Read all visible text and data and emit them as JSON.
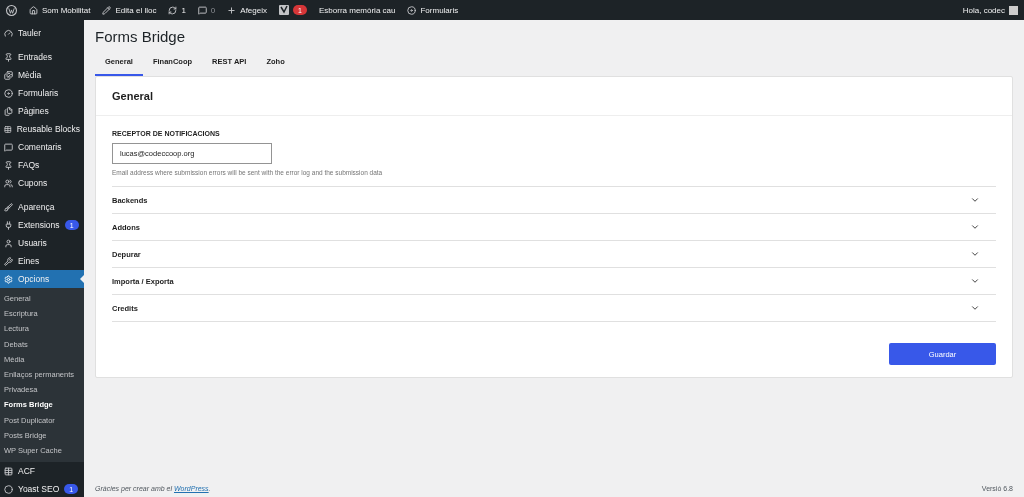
{
  "admin_bar": {
    "items": [
      {
        "kind": "logo"
      },
      {
        "kind": "home",
        "label": "Som Mobilitat"
      },
      {
        "kind": "edit",
        "label": "Edita el lloc"
      },
      {
        "kind": "updates",
        "label": "1"
      },
      {
        "kind": "comments",
        "label": "0"
      },
      {
        "kind": "new",
        "label": "Afegeix"
      },
      {
        "kind": "yoast",
        "badge": "1"
      },
      {
        "kind": "text",
        "label": "Esborra memòria cau"
      },
      {
        "kind": "forms",
        "label": "Formularis"
      }
    ],
    "greeting": "Hola, codec"
  },
  "sidebar": {
    "groups": [
      {
        "items": [
          {
            "kind": "dashboard",
            "label": "Tauler",
            "selected": false
          }
        ]
      },
      {
        "items": [
          {
            "kind": "pin",
            "label": "Entrades",
            "selected": false
          },
          {
            "kind": "media",
            "label": "Mèdia",
            "selected": false
          },
          {
            "kind": "forms",
            "label": "Formularis",
            "selected": false
          },
          {
            "kind": "pages",
            "label": "Pàgines",
            "selected": false
          },
          {
            "kind": "table",
            "label": "Reusable Blocks",
            "selected": false
          },
          {
            "kind": "comment",
            "label": "Comentaris",
            "selected": false
          },
          {
            "kind": "pin",
            "label": "FAQs",
            "selected": false
          },
          {
            "kind": "people",
            "label": "Cupons",
            "selected": false
          }
        ]
      },
      {
        "items": [
          {
            "kind": "brush",
            "label": "Aparença",
            "selected": false
          },
          {
            "kind": "plug",
            "label": "Extensions",
            "badge": "1",
            "selected": false
          },
          {
            "kind": "user",
            "label": "Usuaris",
            "selected": false
          },
          {
            "kind": "wrench",
            "label": "Eines",
            "selected": false
          },
          {
            "kind": "settings",
            "label": "Opcions",
            "selected": true,
            "children": [
              {
                "label": "General",
                "selected": false
              },
              {
                "label": "Escriptura",
                "selected": false
              },
              {
                "label": "Lectura",
                "selected": false
              },
              {
                "label": "Debats",
                "selected": false
              },
              {
                "label": "Mèdia",
                "selected": false
              },
              {
                "label": "Enllaços permanents",
                "selected": false
              },
              {
                "label": "Privadesa",
                "selected": false
              },
              {
                "label": "Forms Bridge",
                "selected": true
              },
              {
                "label": "Post Duplicator",
                "selected": false
              },
              {
                "label": "Posts Bridge",
                "selected": false
              },
              {
                "label": "WP Super Cache",
                "selected": false
              }
            ]
          },
          {
            "kind": "table",
            "label": "ACF",
            "selected": false
          },
          {
            "kind": "yoast",
            "label": "Yoast SEO",
            "badge": "1",
            "selected": false
          }
        ]
      }
    ]
  },
  "page": {
    "title": "Forms Bridge",
    "tabs": [
      {
        "label": "General",
        "selected": true
      },
      {
        "label": "FinanCoop",
        "selected": false
      },
      {
        "label": "REST API",
        "selected": false
      },
      {
        "label": "Zoho",
        "selected": false
      }
    ],
    "panel": {
      "heading": "General",
      "field": {
        "label": "RECEPTOR DE NOTIFICACIONS",
        "value": "lucas@codeccoop.org",
        "help": "Email address where submission errors will be sent with the error log and the submission data"
      },
      "sections": [
        {
          "label": "Backends",
          "expanded": false
        },
        {
          "label": "Addons",
          "expanded": false
        },
        {
          "label": "Depurar",
          "expanded": false
        },
        {
          "label": "Importa / Exporta",
          "expanded": false
        },
        {
          "label": "Credits",
          "expanded": false
        }
      ],
      "save": "Guardar"
    }
  },
  "footer": {
    "text": "Gràcies per crear amb el ",
    "link": "WordPress",
    "after": ".",
    "version": "Versió 6.8"
  }
}
